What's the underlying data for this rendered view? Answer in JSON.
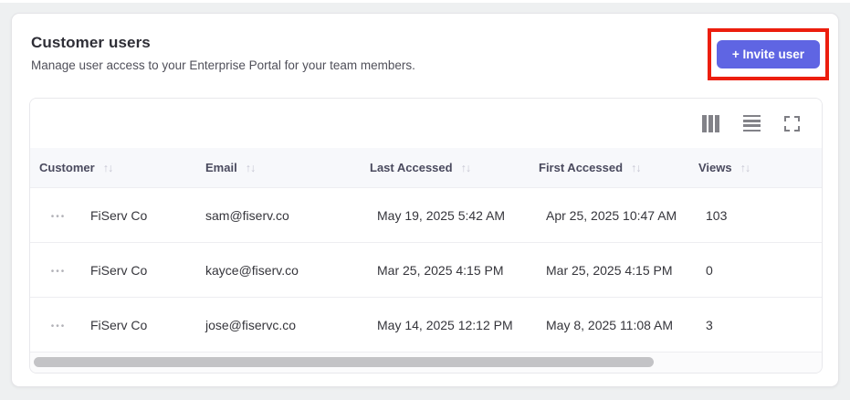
{
  "panel": {
    "title": "Customer users",
    "subtitle": "Manage user access to your Enterprise Portal for your team members.",
    "invite_button": {
      "label": "+ Invite user"
    }
  },
  "toolbar": {
    "icons": [
      "columns-icon",
      "row-density-icon",
      "fullscreen-icon"
    ]
  },
  "table": {
    "sort_icon": "↑↓",
    "row_actions_icon": "•••",
    "columns": [
      {
        "key": "customer",
        "label": "Customer"
      },
      {
        "key": "email",
        "label": "Email"
      },
      {
        "key": "last_accessed",
        "label": "Last Accessed"
      },
      {
        "key": "first_accessed",
        "label": "First Accessed"
      },
      {
        "key": "views",
        "label": "Views"
      }
    ],
    "rows": [
      {
        "customer": "FiServ Co",
        "email": "sam@fiserv.co",
        "last_accessed": "May 19, 2025 5:42 AM",
        "first_accessed": "Apr 25, 2025 10:47 AM",
        "views": "103"
      },
      {
        "customer": "FiServ Co",
        "email": "kayce@fiserv.co",
        "last_accessed": "Mar 25, 2025 4:15 PM",
        "first_accessed": "Mar 25, 2025 4:15 PM",
        "views": "0"
      },
      {
        "customer": "FiServ Co",
        "email": "jose@fiservc.co",
        "last_accessed": "May 14, 2025 12:12 PM",
        "first_accessed": "May 8, 2025 11:08 AM",
        "views": "3"
      }
    ],
    "scrollbar": {
      "thumb_percent": 79
    }
  },
  "colors": {
    "page_bg": "#eef0f1",
    "accent_button": "#5f65e3",
    "highlight_red": "#ec1e0e",
    "header_row_bg": "#f7f8fb",
    "icon_gray": "#828288"
  }
}
